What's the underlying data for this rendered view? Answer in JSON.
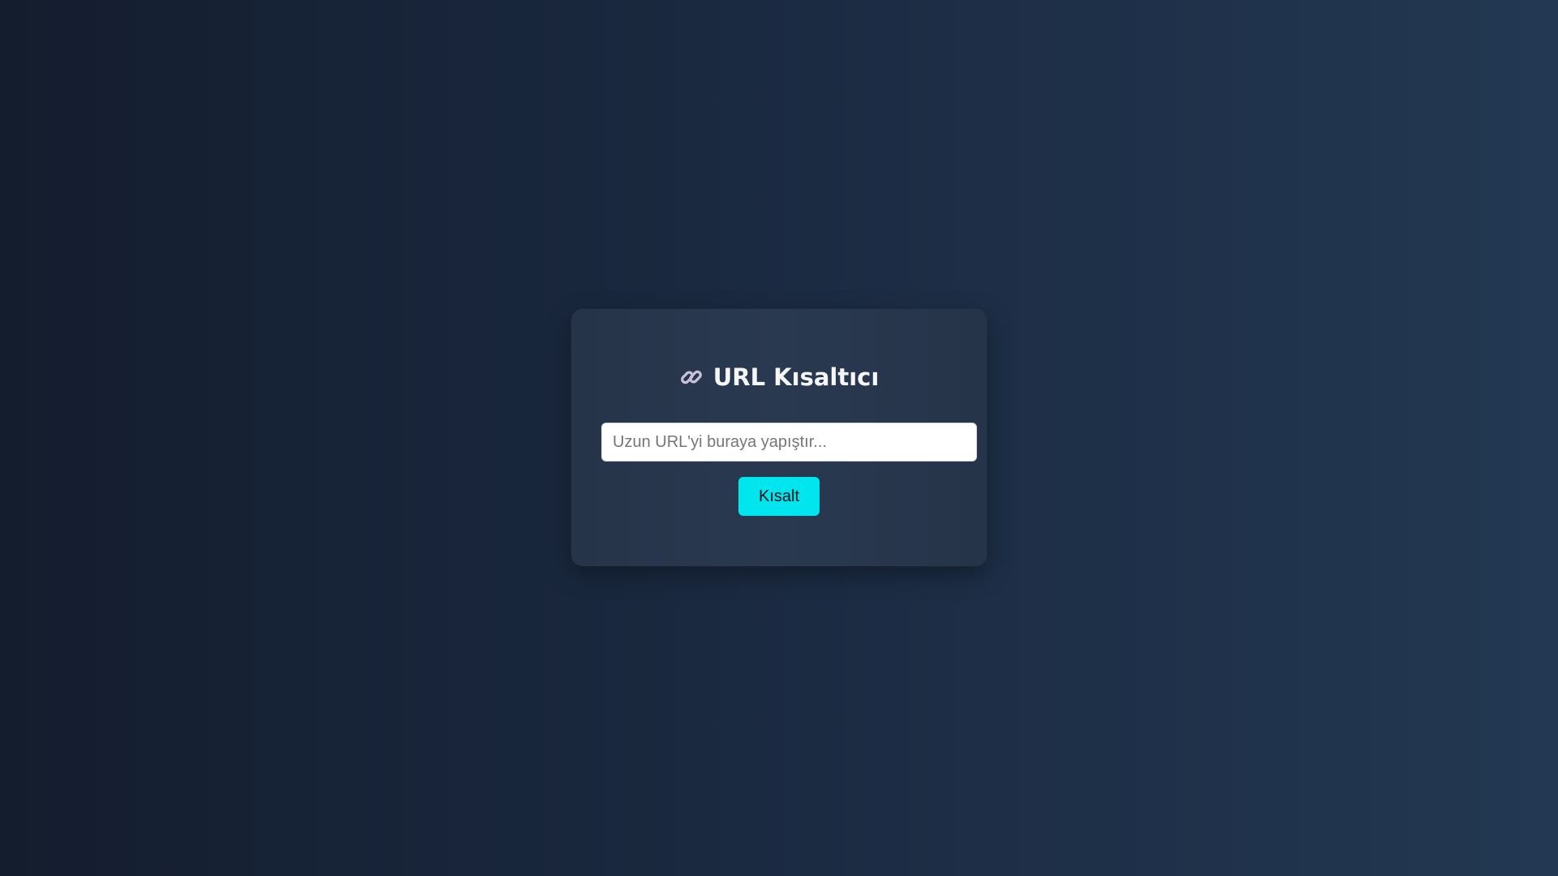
{
  "page": {
    "title": "URL Kısaltıcı",
    "icon": "link-icon"
  },
  "form": {
    "url_placeholder": "Uzun URL'yi buraya yapıştır...",
    "url_value": "",
    "submit_label": "Kısalt"
  },
  "colors": {
    "background_dark": "#141d2e",
    "background_light": "#233852",
    "card": "#283750",
    "accent": "#00e5ee",
    "title_text": "#f4f6fa"
  }
}
